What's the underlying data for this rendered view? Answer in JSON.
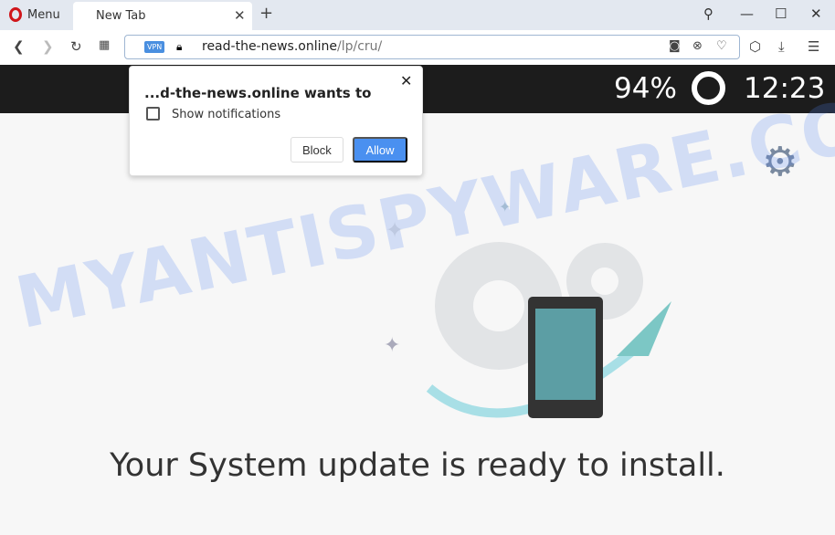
{
  "browser": {
    "menu_label": "Menu",
    "tab_title": "New Tab",
    "vpn_badge": "VPN",
    "url_host": "read-the-news.online",
    "url_path": "/lp/cru/"
  },
  "page": {
    "battery": "94%",
    "clock": "12:23",
    "headline": "Your System update is ready to install.",
    "watermark": "MYANTISPYWARE.COM"
  },
  "popup": {
    "title": "...d-the-news.online wants to",
    "permission": "Show notifications",
    "block_label": "Block",
    "allow_label": "Allow"
  },
  "colors": {
    "accent": "#4a90f0",
    "opera_red": "#d0161b"
  }
}
